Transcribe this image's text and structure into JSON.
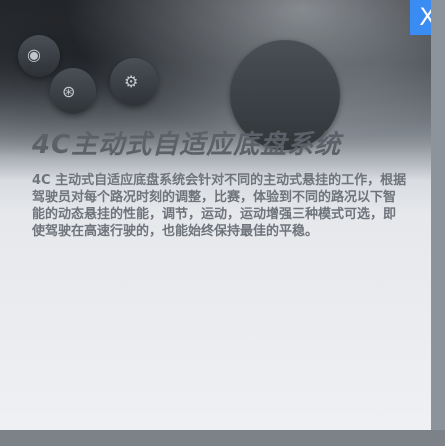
{
  "popup": {
    "title": "4C主动式自适应底盘系统",
    "body": "4C 主动式自适应底盘系统会针对不同的主动式悬挂的工作，根据驾驶员对每个路况时刻的调整，比赛，体验到不同的路况以下智能的动态悬挂的性能，调节，运动，运动增强三种模式可选，即使驾驶在高速行驶的，也能始终保持最佳的平稳。",
    "close_label": "X"
  },
  "icons": {
    "close": "close-icon",
    "dash_buttons": [
      "camera-icon",
      "steering-icon",
      "wrench-icon"
    ]
  },
  "colors": {
    "close_bg": "#3a8bf2",
    "title": "#5c6068",
    "body": "#6f747b"
  }
}
